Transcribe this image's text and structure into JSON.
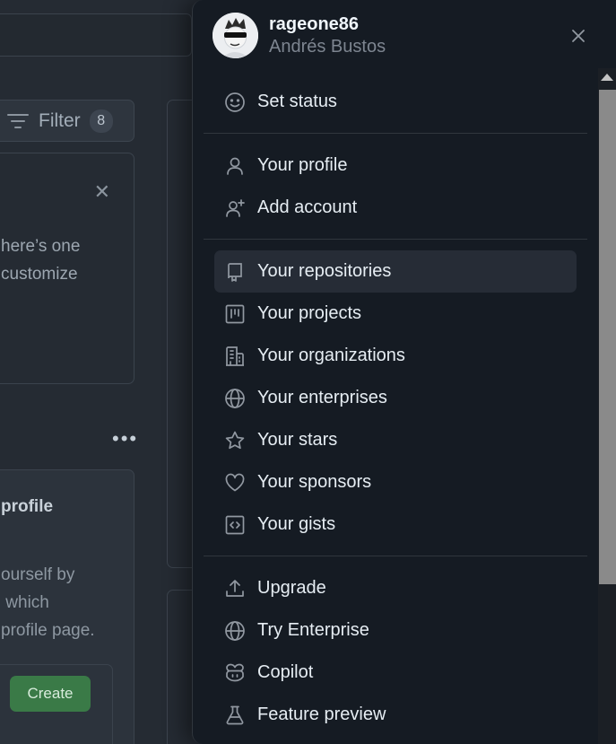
{
  "background": {
    "filter_label": "Filter",
    "filter_count": "8",
    "card1_text_line1": "here’s one",
    "card1_text_line2": "customize",
    "card2_heading": "profile",
    "card2_text_line1": "ourself by",
    "card2_text_line2": " which",
    "card2_text_line3": "profile page.",
    "create_label": "Create"
  },
  "drawer": {
    "username": "rageone86",
    "full_name": "Andrés Bustos",
    "groups": [
      [
        {
          "label": "Set status",
          "icon": "smiley-icon"
        }
      ],
      [
        {
          "label": "Your profile",
          "icon": "person-icon"
        },
        {
          "label": "Add account",
          "icon": "person-add-icon"
        }
      ],
      [
        {
          "label": "Your repositories",
          "icon": "repo-icon",
          "active": true
        },
        {
          "label": "Your projects",
          "icon": "project-icon"
        },
        {
          "label": "Your organizations",
          "icon": "organization-icon"
        },
        {
          "label": "Your enterprises",
          "icon": "globe-icon"
        },
        {
          "label": "Your stars",
          "icon": "star-icon"
        },
        {
          "label": "Your sponsors",
          "icon": "heart-icon"
        },
        {
          "label": "Your gists",
          "icon": "code-square-icon"
        }
      ],
      [
        {
          "label": "Upgrade",
          "icon": "upload-icon"
        },
        {
          "label": "Try Enterprise",
          "icon": "globe-icon"
        },
        {
          "label": "Copilot",
          "icon": "copilot-icon"
        },
        {
          "label": "Feature preview",
          "icon": "beaker-icon"
        }
      ]
    ]
  },
  "colors": {
    "drawer_bg": "#151b23",
    "active_item_bg": "#262c36",
    "create_button": "#3a7a47"
  }
}
